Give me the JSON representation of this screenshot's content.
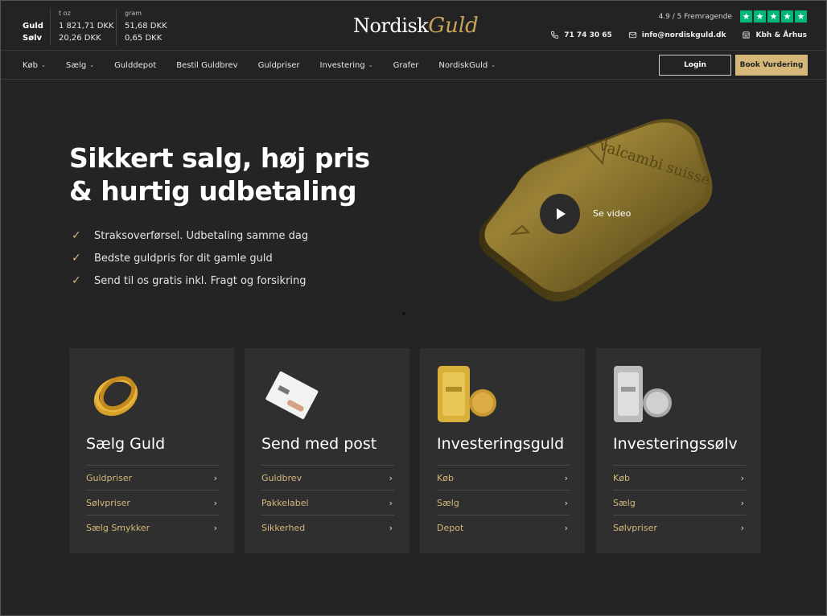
{
  "metal_prices": {
    "gold_label": "Guld",
    "silver_label": "Sølv",
    "col1_unit": "t oz",
    "col2_unit": "gram",
    "gold_toz": "1 821,71 DKK",
    "silver_toz": "20,26 DKK",
    "gold_gram": "51,68 DKK",
    "silver_gram": "0,65 DKK"
  },
  "logo": {
    "part1": "Nordisk",
    "part2": "Guld"
  },
  "rating": {
    "text": "4.9 / 5 Fremragende",
    "star_color": "#00b67a"
  },
  "contacts": {
    "phone": "71 74 30 65",
    "email": "info@nordiskguld.dk",
    "locations": "Kbh & Århus"
  },
  "nav": {
    "items": [
      {
        "label": "Køb",
        "dropdown": true
      },
      {
        "label": "Sælg",
        "dropdown": true
      },
      {
        "label": "Gulddepot",
        "dropdown": false
      },
      {
        "label": "Bestil Guldbrev",
        "dropdown": false
      },
      {
        "label": "Guldpriser",
        "dropdown": false
      },
      {
        "label": "Investering",
        "dropdown": true
      },
      {
        "label": "Grafer",
        "dropdown": false
      },
      {
        "label": "NordiskGuld",
        "dropdown": true
      }
    ],
    "login_label": "Login",
    "book_label": "Book Vurdering"
  },
  "hero": {
    "title_line1": "Sikkert salg, høj pris",
    "title_line2": "& hurtig udbetaling",
    "bullets": [
      "Straksoverførsel. Udbetaling samme dag",
      "Bedste guldpris for dit gamle guld",
      "Send til os gratis inkl. Fragt og forsikring"
    ],
    "video_label": "Se video",
    "bar_engraving": "valcambi suisse"
  },
  "cards": [
    {
      "title": "Sælg Guld",
      "links": [
        "Guldpriser",
        "Sølvpriser",
        "Sælg Smykker"
      ]
    },
    {
      "title": "Send med post",
      "links": [
        "Guldbrev",
        "Pakkelabel",
        "Sikkerhed"
      ]
    },
    {
      "title": "Investeringsguld",
      "links": [
        "Køb",
        "Sælg",
        "Depot"
      ]
    },
    {
      "title": "Investeringssølv",
      "links": [
        "Køb",
        "Sælg",
        "Sølvpriser"
      ]
    }
  ],
  "colors": {
    "background": "#232323",
    "accent_gold": "#d6b77a",
    "card_bg": "#2f2f2f"
  }
}
